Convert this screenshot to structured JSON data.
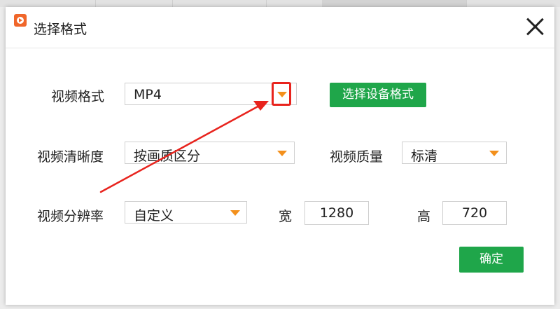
{
  "dialog": {
    "title": "选择格式",
    "icon": "app-logo-icon",
    "close_icon": "close-icon"
  },
  "rows": {
    "video_format": {
      "label": "视频格式",
      "value": "MP4",
      "button_label": "选择设备格式"
    },
    "video_clarity": {
      "label": "视频清晰度",
      "value": "按画质区分",
      "quality_label": "视频质量",
      "quality_value": "标清"
    },
    "video_resolution": {
      "label": "视频分辨率",
      "value": "自定义",
      "width_label": "宽",
      "width_value": "1280",
      "height_label": "高",
      "height_value": "720"
    }
  },
  "confirm_label": "确定",
  "colors": {
    "accent_green": "#1fa64a",
    "dropdown_arrow": "#f3901c",
    "annotation_red": "#e8231d"
  }
}
